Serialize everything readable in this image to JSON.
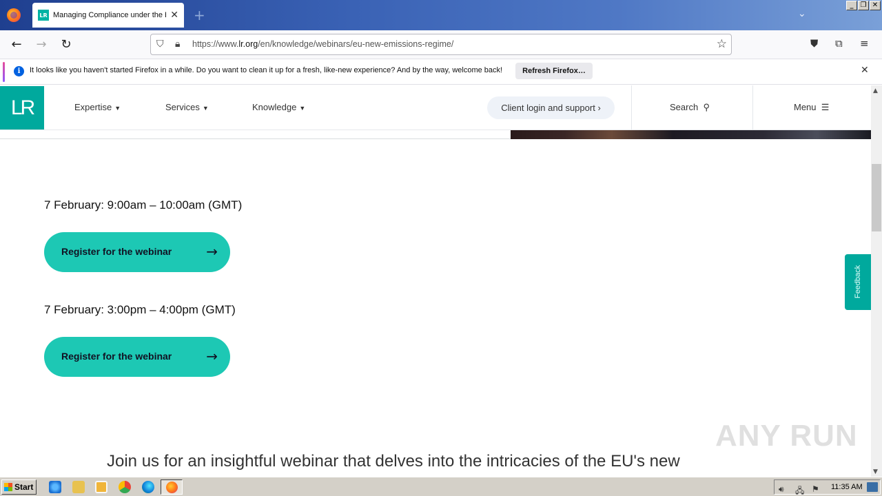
{
  "browser": {
    "tab_title": "Managing Compliance under the EU",
    "tab_favicon_text": "LR",
    "new_tab_glyph": "+",
    "url_prefix": "https://www.",
    "url_host": "lr.org",
    "url_path": "/en/knowledge/webinars/eu-new-emissions-regime/",
    "notification": "It looks like you haven't started Firefox in a while. Do you want to clean it up for a fresh, like-new experience? And by the way, welcome back!",
    "refresh_label": "Refresh Firefox…"
  },
  "site": {
    "logo_text": "LR",
    "nav": [
      {
        "label": "Expertise"
      },
      {
        "label": "Services"
      },
      {
        "label": "Knowledge"
      }
    ],
    "client_login": "Client login and support",
    "search": "Search",
    "menu": "Menu",
    "feedback": "Feedback"
  },
  "sessions": [
    {
      "date": "7 February: 9:00am – 10:00am (GMT)",
      "button": "Register for the webinar"
    },
    {
      "date": "7 February: 3:00pm – 4:00pm (GMT)",
      "button": "Register for the webinar"
    }
  ],
  "intro_text": "Join us for an insightful webinar that delves into the intricacies of the EU's new",
  "watermark": "ANY RUN",
  "taskbar": {
    "start": "Start",
    "clock": "11:35 AM"
  },
  "colors": {
    "accent": "#1dc8b4",
    "brand": "#00a99d"
  }
}
